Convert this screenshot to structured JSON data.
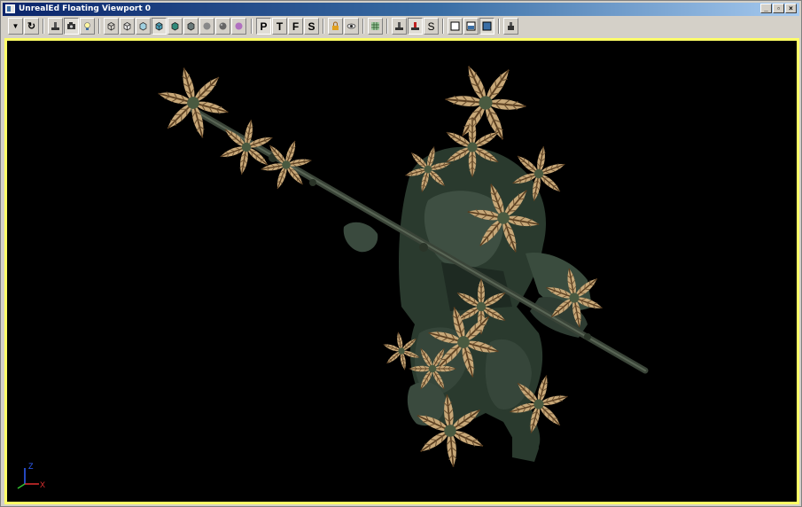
{
  "window": {
    "title": "UnrealEd Floating Viewport 0",
    "caption_buttons": [
      "minimize",
      "restore",
      "close"
    ]
  },
  "toolbar": {
    "buttons": [
      {
        "id": "menu-dropdown",
        "icon": "dropdown-arrow-icon"
      },
      {
        "id": "realtime-toggle",
        "icon": "refresh-icon"
      },
      {
        "id": "actor-view",
        "icon": "actor-icon"
      },
      {
        "id": "camera-view",
        "icon": "camera-icon"
      },
      {
        "id": "light-view",
        "icon": "lightbulb-icon"
      },
      {
        "id": "wireframe",
        "icon": "wireframe-cube-icon"
      },
      {
        "id": "zone-view",
        "icon": "zone-cube-icon"
      },
      {
        "id": "bsp-view",
        "icon": "bsp-cube-icon"
      },
      {
        "id": "textured-view",
        "icon": "textured-cube-icon"
      },
      {
        "id": "dynamic-light",
        "icon": "lit-cube-icon"
      },
      {
        "id": "brush-view",
        "icon": "brush-cube-icon"
      },
      {
        "id": "unlit-view",
        "icon": "unlit-sphere-icon"
      },
      {
        "id": "depth-view",
        "icon": "depth-sphere-icon"
      },
      {
        "id": "lighting-only",
        "icon": "purple-sphere-icon"
      },
      {
        "id": "perspective",
        "label": "P"
      },
      {
        "id": "top",
        "label": "T"
      },
      {
        "id": "front",
        "label": "F"
      },
      {
        "id": "side",
        "label": "S"
      },
      {
        "id": "lock",
        "icon": "lock-icon"
      },
      {
        "id": "show-flags",
        "icon": "eye-icon"
      },
      {
        "id": "grid",
        "icon": "grid-icon"
      },
      {
        "id": "actor-lock",
        "icon": "actor-icon"
      },
      {
        "id": "actor-selected",
        "icon": "red-actor-icon"
      },
      {
        "id": "sound-view",
        "label": "S"
      },
      {
        "id": "layout-single",
        "icon": "single-pane-icon"
      },
      {
        "id": "layout-split",
        "icon": "split-pane-icon"
      },
      {
        "id": "layout-active",
        "icon": "blue-pane-icon"
      },
      {
        "id": "detach",
        "icon": "detach-icon"
      }
    ]
  },
  "viewport": {
    "background": "#000000",
    "border_color": "#ffff66",
    "axis": {
      "z": "Z",
      "x": "X"
    }
  }
}
